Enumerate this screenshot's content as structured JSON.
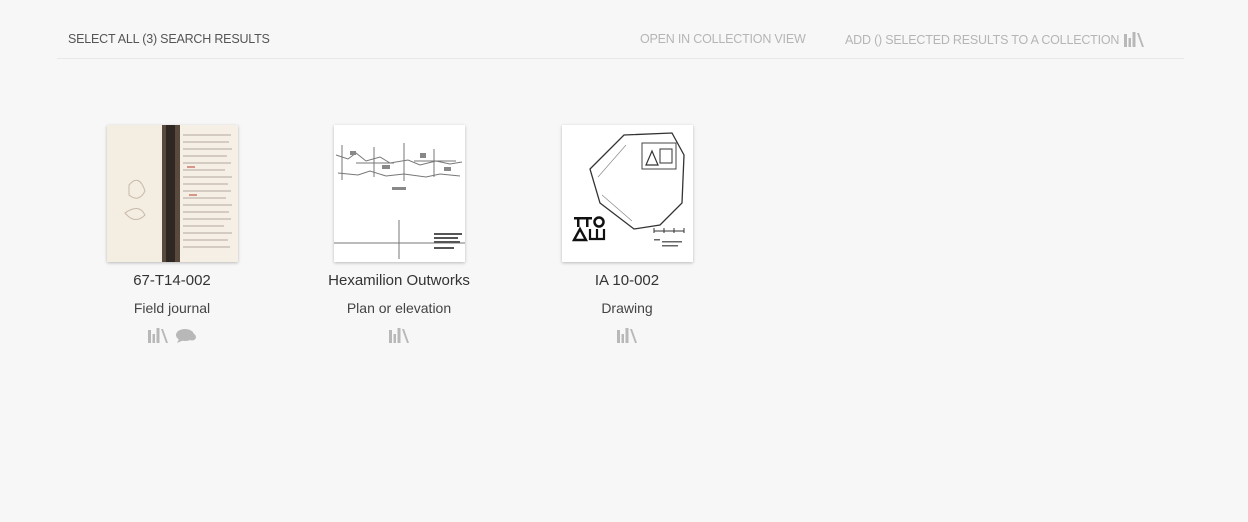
{
  "toolbar": {
    "select_all": "SELECT ALL (3) SEARCH RESULTS",
    "open_collection_view": "OPEN IN COLLECTION VIEW",
    "add_to_collection": "ADD () SELECTED RESULTS TO A COLLECTION",
    "add_icon": "library-icon"
  },
  "results": [
    {
      "title": "67-T14-002",
      "type": "Field journal",
      "thumbnail": "notebook-page-image",
      "icons": [
        "library-icon",
        "comment-icon"
      ]
    },
    {
      "title": "Hexamilion Outworks",
      "type": "Plan or elevation",
      "thumbnail": "plan-drawing-image",
      "icons": [
        "library-icon"
      ]
    },
    {
      "title": "IA 10-002",
      "type": "Drawing",
      "thumbnail": "artifact-drawing-image",
      "icons": [
        "library-icon"
      ]
    }
  ],
  "colors": {
    "background": "#f7f7f7",
    "muted_text": "#b5b5b5",
    "icon_gray": "#b8b8b8"
  }
}
